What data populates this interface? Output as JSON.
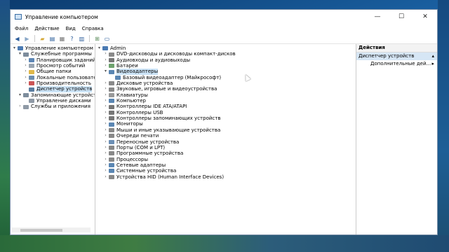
{
  "window": {
    "title": "Управление компьютером",
    "controls": {
      "minimize": "—",
      "maximize": "☐",
      "close": "✕"
    }
  },
  "menu": [
    "Файл",
    "Действие",
    "Вид",
    "Справка"
  ],
  "toolbar": {
    "icons": [
      "back-arrow-icon",
      "forward-arrow-icon",
      "folder-up-icon",
      "show-hide-tree-icon",
      "properties-icon",
      "help-icon",
      "view-icon",
      "scan-hardware-icon",
      "monitor-icon"
    ]
  },
  "left_tree": [
    {
      "label": "Управление компьютером (л",
      "indent": 0,
      "arrow": "▾",
      "selected": false,
      "icon_color": "#4a7ab3"
    },
    {
      "label": "Служебные программы",
      "indent": 1,
      "arrow": "▾",
      "selected": false,
      "icon_color": "#7d8c9c"
    },
    {
      "label": "Планировщик заданий",
      "indent": 2,
      "arrow": "›",
      "selected": false,
      "icon_color": "#5d86b5"
    },
    {
      "label": "Просмотр событий",
      "indent": 2,
      "arrow": "›",
      "selected": false,
      "icon_color": "#9aa6b2"
    },
    {
      "label": "Общие папки",
      "indent": 2,
      "arrow": "›",
      "selected": false,
      "icon_color": "#e0b84a"
    },
    {
      "label": "Локальные пользовате",
      "indent": 2,
      "arrow": "›",
      "selected": false,
      "icon_color": "#6d8fb0"
    },
    {
      "label": "Производительность",
      "indent": 2,
      "arrow": "›",
      "selected": false,
      "icon_color": "#c55"
    },
    {
      "label": "Диспетчер устройств",
      "indent": 2,
      "arrow": "",
      "selected": true,
      "icon_color": "#5a7d9f"
    },
    {
      "label": "Запоминающие устройств",
      "indent": 1,
      "arrow": "▾",
      "selected": false,
      "icon_color": "#7d8c9c"
    },
    {
      "label": "Управление дисками",
      "indent": 2,
      "arrow": "",
      "selected": false,
      "icon_color": "#8f9aa6"
    },
    {
      "label": "Службы и приложения",
      "indent": 1,
      "arrow": "›",
      "selected": false,
      "icon_color": "#8f9aa6"
    }
  ],
  "device_tree": [
    {
      "label": "Admin",
      "indent": 0,
      "arrow": "▾",
      "icon_color": "#4a7ab3"
    },
    {
      "label": "DVD-дисководы и дисководы компакт-дисков",
      "indent": 1,
      "arrow": "›",
      "icon_color": "#8a8a8a"
    },
    {
      "label": "Аудиовходы и аудиовыходы",
      "indent": 1,
      "arrow": "›",
      "icon_color": "#777"
    },
    {
      "label": "Батареи",
      "indent": 1,
      "arrow": "›",
      "icon_color": "#6fa36f"
    },
    {
      "label": "Видеоадаптеры",
      "indent": 1,
      "arrow": "▾",
      "icon_color": "#5a86b3",
      "selected": true
    },
    {
      "label": "Базовый видеоадаптер (Майкрософт)",
      "indent": 2,
      "arrow": "",
      "icon_color": "#5a86b3"
    },
    {
      "label": "Дисковые устройства",
      "indent": 1,
      "arrow": "›",
      "icon_color": "#8a8a8a"
    },
    {
      "label": "Звуковые, игровые и видеоустройства",
      "indent": 1,
      "arrow": "›",
      "icon_color": "#888"
    },
    {
      "label": "Клавиатуры",
      "indent": 1,
      "arrow": "›",
      "icon_color": "#999"
    },
    {
      "label": "Компьютер",
      "indent": 1,
      "arrow": "›",
      "icon_color": "#5a86b3"
    },
    {
      "label": "Контроллеры IDE ATA/ATAPI",
      "indent": 1,
      "arrow": "›",
      "icon_color": "#777"
    },
    {
      "label": "Контроллеры USB",
      "indent": 1,
      "arrow": "›",
      "icon_color": "#777"
    },
    {
      "label": "Контроллеры запоминающих устройств",
      "indent": 1,
      "arrow": "›",
      "icon_color": "#777"
    },
    {
      "label": "Мониторы",
      "indent": 1,
      "arrow": "›",
      "icon_color": "#5a86b3"
    },
    {
      "label": "Мыши и иные указывающие устройства",
      "indent": 1,
      "arrow": "›",
      "icon_color": "#888"
    },
    {
      "label": "Очереди печати",
      "indent": 1,
      "arrow": "›",
      "icon_color": "#888"
    },
    {
      "label": "Переносные устройства",
      "indent": 1,
      "arrow": "›",
      "icon_color": "#6c8fb5"
    },
    {
      "label": "Порты (COM и LPT)",
      "indent": 1,
      "arrow": "›",
      "icon_color": "#888"
    },
    {
      "label": "Программные устройства",
      "indent": 1,
      "arrow": "›",
      "icon_color": "#888"
    },
    {
      "label": "Процессоры",
      "indent": 1,
      "arrow": "›",
      "icon_color": "#888"
    },
    {
      "label": "Сетевые адаптеры",
      "indent": 1,
      "arrow": "›",
      "icon_color": "#5a86b3"
    },
    {
      "label": "Системные устройства",
      "indent": 1,
      "arrow": "›",
      "icon_color": "#5a86b3"
    },
    {
      "label": "Устройства HID (Human Interface Devices)",
      "indent": 1,
      "arrow": "›",
      "icon_color": "#888"
    }
  ],
  "actions": {
    "title": "Действия",
    "section": "Диспетчер устройств",
    "section_arrow": "▴",
    "item": "Дополнительные дей...",
    "item_arrow": "▸"
  },
  "colors": {
    "selection": "#cce4f7",
    "section_bg": "#d6e6f5"
  }
}
